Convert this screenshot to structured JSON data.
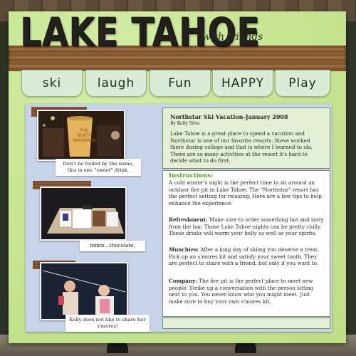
{
  "title": "LAKE TAHOE",
  "subtitle": "with friends",
  "tabs": [
    "ski",
    "laugh",
    "Fun",
    "HAPPY",
    "Play"
  ],
  "photos": {
    "photo1": {
      "mug_text": "THE BEATY SNOWMAN"
    }
  },
  "captions": [
    "Don't be fooled by the name, this is one \"sweet\" drink.",
    "mmm.. chocolate.",
    "Kelly does not like to share her s'mores!"
  ],
  "journal": {
    "heading": "Northstar Ski Vacation-January 2008",
    "byline": "By Kelly Silva",
    "intro": "Lake Tahoe is a great place to spend a vacation and Northstar is one of our favorite resorts. Steve worked there during college and that is where I learned to ski. There are so many activities at the resort it's hard to decide what to do first.",
    "instructions_label": "Instructions:",
    "instructions_text": "A cold winter's night is the perfect time to sit around an outdoor fire pit in Lake Tahoe. The \"Northstar\" resort has the perfect setting for relaxing. Here are a few tips to help enhance the experience.",
    "sections": [
      {
        "label": "Refreshment:",
        "text": "Make sure to order something hot and tasty from the bar. Those Lake Tahoe nights can be pretty chilly. These drinks will warm your belly as well as your spirits."
      },
      {
        "label": "Munchies:",
        "text": "After a long day of skiing you deserve a treat. Pick up an s'mores kit and satisfy your sweet tooth. They are perfect to share with a friend, but only if you want to."
      },
      {
        "label": "Company:",
        "text": "The fire pit is the perfect place to meet new people. Strike up a conversation with the person sitting next to you. You never know who you might meet. Just make sure to buy your own s'mores kit."
      }
    ]
  }
}
